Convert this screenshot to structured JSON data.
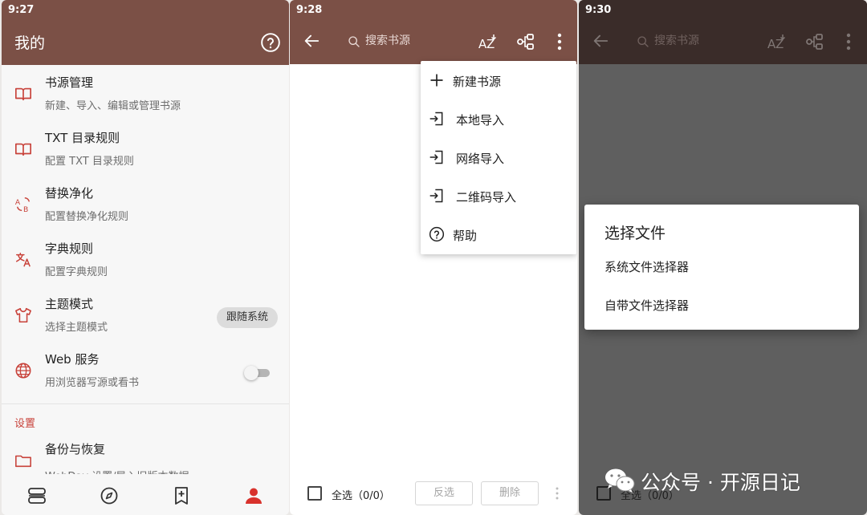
{
  "colors": {
    "brand_brown": "#7b5046",
    "accent_red": "#c8423a",
    "dim_overlay": "#5f5f5f"
  },
  "phone1": {
    "status_time": "9:27",
    "title": "我的",
    "help_icon": "help-circle-icon",
    "items": [
      {
        "icon": "book-open-icon",
        "title": "书源管理",
        "summary": "新建、导入、编辑或管理书源"
      },
      {
        "icon": "book-open-icon",
        "title": "TXT 目录规则",
        "summary": "配置 TXT 目录规则"
      },
      {
        "icon": "replace-ab-icon",
        "title": "替换净化",
        "summary": "配置替换净化规则"
      },
      {
        "icon": "translate-icon",
        "title": "字典规则",
        "summary": "配置字典规则"
      },
      {
        "icon": "tshirt-icon",
        "title": "主题模式",
        "summary": "选择主题模式",
        "chip": "跟随系统"
      },
      {
        "icon": "globe-icon",
        "title": "Web 服务",
        "summary": "用浏览器写源或看书",
        "toggle": false
      }
    ],
    "section_header": "设置",
    "backup_item": {
      "icon": "folder-icon",
      "title": "备份与恢复",
      "summary": "WebDav 设置/导入旧版本数据"
    },
    "bottom_nav": [
      "bookshelf-icon",
      "compass-icon",
      "bookmark-add-icon",
      "person-icon"
    ]
  },
  "phone2": {
    "status_time": "9:28",
    "search_placeholder": "搜索书源",
    "menu": [
      {
        "icon": "plus-icon",
        "label": "新建书源"
      },
      {
        "icon": "import-icon",
        "label": "本地导入"
      },
      {
        "icon": "import-icon",
        "label": "网络导入"
      },
      {
        "icon": "import-icon",
        "label": "二维码导入"
      },
      {
        "icon": "help-circle-icon",
        "label": "帮助"
      }
    ],
    "select_all": "全选（0/0）",
    "invert_button": "反选",
    "delete_button": "删除"
  },
  "phone3": {
    "status_time": "9:30",
    "search_placeholder": "搜索书源",
    "dialog_title": "选择文件",
    "options": [
      "系统文件选择器",
      "自带文件选择器"
    ],
    "select_all": "全选（0/0）"
  },
  "watermark": {
    "text": "公众号 · 开源日记"
  }
}
